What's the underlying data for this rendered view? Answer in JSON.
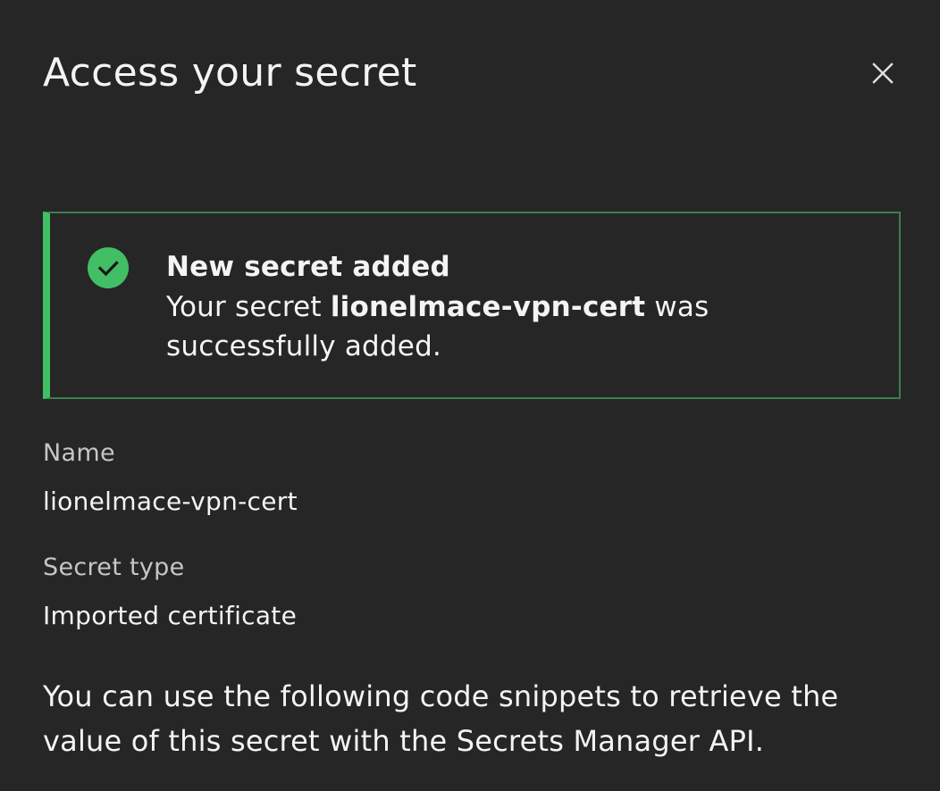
{
  "modal": {
    "title": "Access your secret",
    "close_icon": "close-icon"
  },
  "notification": {
    "kind": "success",
    "icon": "checkmark-filled-icon",
    "accent_color": "#42be65",
    "title": "New secret added",
    "body_prefix": "Your secret ",
    "body_secret_name": "lionelmace-vpn-cert",
    "body_suffix": " was successfully added."
  },
  "details": {
    "name_label": "Name",
    "name_value": "lionelmace-vpn-cert",
    "type_label": "Secret type",
    "type_value": "Imported certificate"
  },
  "description": "You can use the following code snippets to retrieve the value of this secret with the Secrets Manager API."
}
